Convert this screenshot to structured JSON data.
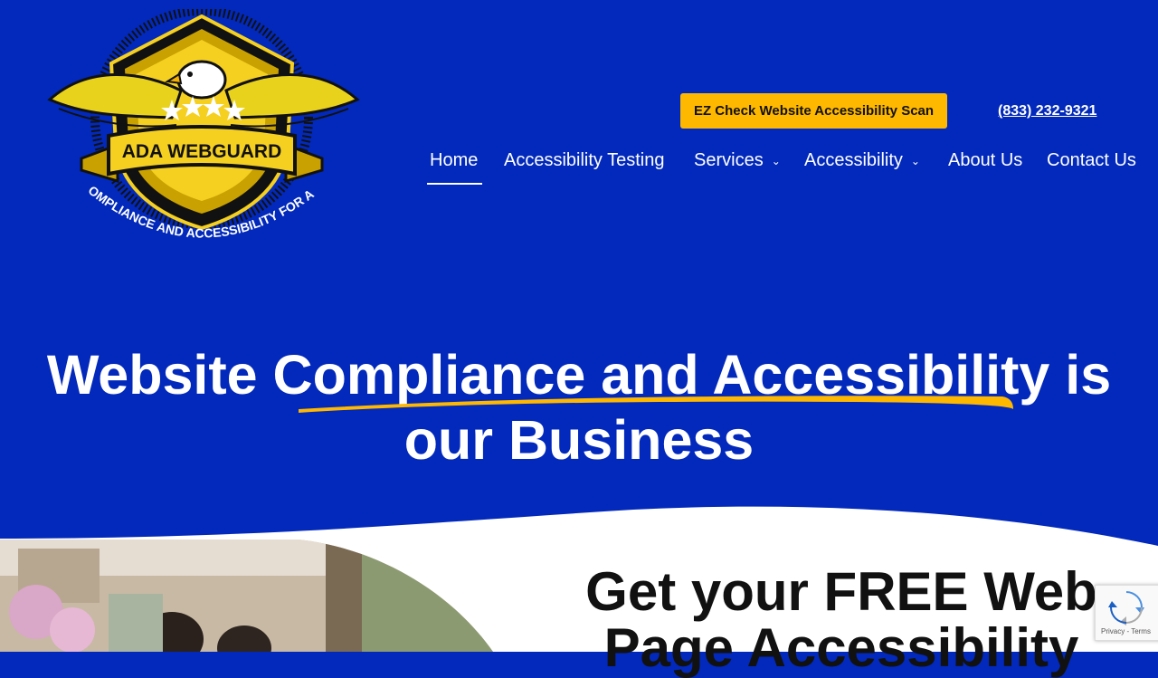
{
  "brand": {
    "name": "ADA WEBGUARD",
    "tagline": "COMPLIANCE AND ACCESSIBILITY FOR ALL"
  },
  "header": {
    "cta_label": "EZ Check Website Accessibility Scan",
    "phone": "(833) 232-9321"
  },
  "nav": {
    "items": [
      {
        "label": "Home",
        "active": true
      },
      {
        "label": "Accessibility Testing"
      },
      {
        "label": "Services",
        "dropdown": true
      },
      {
        "label": "Accessibility",
        "dropdown": true
      },
      {
        "label": "About Us"
      },
      {
        "label": "Contact Us"
      }
    ]
  },
  "hero": {
    "title_part1": "Website ",
    "title_highlight": "Compliance and Accessibility",
    "title_part2": " is",
    "title_line2": "our Business"
  },
  "promo": {
    "title": "Get your FREE Web Page Accessibility"
  },
  "recaptcha": {
    "links": "Privacy - Terms"
  },
  "colors": {
    "background": "#0229bb",
    "accent": "#ffb800",
    "text": "#ffffff",
    "dark_text": "#111111"
  }
}
